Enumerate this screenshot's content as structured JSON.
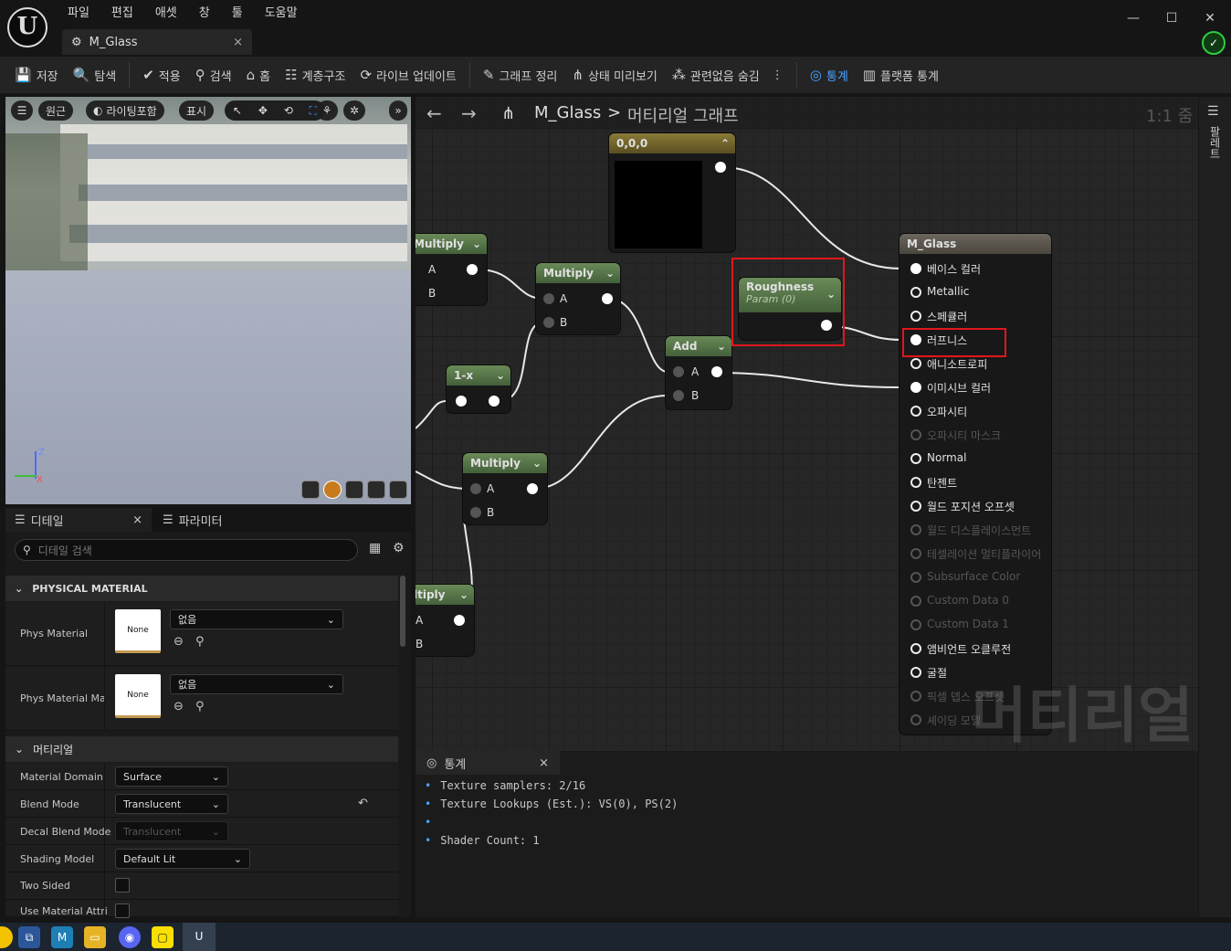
{
  "window": {
    "logo": "U",
    "menu": [
      "파일",
      "편집",
      "애셋",
      "창",
      "툴",
      "도움말"
    ],
    "tab_title": "M_Glass",
    "close": "×",
    "controls": {
      "minimize": "—",
      "maximize": "☐",
      "close": "✕"
    }
  },
  "toolbar": {
    "save": "저장",
    "browse": "탐색",
    "apply": "적용",
    "search": "검색",
    "home": "홈",
    "hierarchy": "계층구조",
    "live_update": "라이브 업데이트",
    "clean_graph": "그래프 정리",
    "preview_state": "상태 미리보기",
    "hide_unrelated": "관련없음 숨김",
    "stats": "통계",
    "platform_stats": "플랫폼 통계"
  },
  "viewport": {
    "perspective": "원근",
    "lighting": "라이팅포함",
    "show": "표시",
    "axis_z": "Z",
    "axis_x": "X"
  },
  "details": {
    "tab_details": "디테일",
    "tab_params": "파라미터",
    "search_placeholder": "디테일 검색",
    "physical_section": "PHYSICAL MATERIAL",
    "phys_material_label": "Phys Material",
    "phys_material_thumb": "None",
    "phys_material_value": "없음",
    "phys_material_mask_label": "Phys Material Ma",
    "phys_material_mask_thumb": "None",
    "phys_material_mask_value": "없음",
    "material_section": "머티리얼",
    "props": [
      {
        "label": "Material Domain",
        "value": "Surface"
      },
      {
        "label": "Blend Mode",
        "value": "Translucent"
      },
      {
        "label": "Decal Blend Mode",
        "value": "Translucent"
      },
      {
        "label": "Shading Model",
        "value": "Default Lit"
      },
      {
        "label": "Two Sided",
        "value": ""
      },
      {
        "label": "Use Material Attri",
        "value": ""
      }
    ]
  },
  "graph": {
    "breadcrumb_asset": "M_Glass",
    "breadcrumb_sep": ">",
    "breadcrumb_graph": "머티리얼 그래프",
    "zoom": "1:1 줌",
    "palette": "팔레트",
    "nodes": {
      "const": "0,0,0",
      "mult1": "Multiply",
      "mult2": "Multiply",
      "mult3": "Multiply",
      "mult4": "ltiply",
      "oneminus": "1-x",
      "add": "Add",
      "roughness_title": "Roughness",
      "roughness_sub": "Param (0)",
      "pin_a": "A",
      "pin_b": "B"
    },
    "result_title": "M_Glass",
    "result_pins": [
      {
        "label": "베이스 컬러",
        "on": true
      },
      {
        "label": "Metallic",
        "on": false
      },
      {
        "label": "스페큘러",
        "on": false
      },
      {
        "label": "러프니스",
        "on": true
      },
      {
        "label": "애니소트로피",
        "on": false
      },
      {
        "label": "이미시브 컬러",
        "on": true
      },
      {
        "label": "오파시티",
        "on": false
      },
      {
        "label": "오파시티 마스크",
        "dim": true
      },
      {
        "label": "Normal",
        "on": false
      },
      {
        "label": "탄젠트",
        "on": false
      },
      {
        "label": "월드 포지션 오프셋",
        "on": false
      },
      {
        "label": "월드 디스플레이스먼트",
        "dim": true
      },
      {
        "label": "테셀레이션 멀티플라이어",
        "dim": true
      },
      {
        "label": "Subsurface Color",
        "dim": true
      },
      {
        "label": "Custom Data 0",
        "dim": true
      },
      {
        "label": "Custom Data 1",
        "dim": true
      },
      {
        "label": "앰비언트 오클루전",
        "on": false
      },
      {
        "label": "굴절",
        "on": false
      },
      {
        "label": "픽셀 뎁스 오프셋",
        "dim": true
      },
      {
        "label": "셰이딩 모델",
        "dim": true
      }
    ],
    "watermark": "머티리얼"
  },
  "stats": {
    "tab": "통계",
    "close": "×",
    "lines": [
      "Texture samplers: 2/16",
      "Texture Lookups (Est.): VS(0), PS(2)",
      "",
      "Shader Count: 1"
    ],
    "bullet": "•"
  },
  "colors": {
    "accent": "#4aa3ff",
    "highlight": "#e0161c",
    "math_node": "#54733f",
    "const_node": "#7a6a2c"
  }
}
